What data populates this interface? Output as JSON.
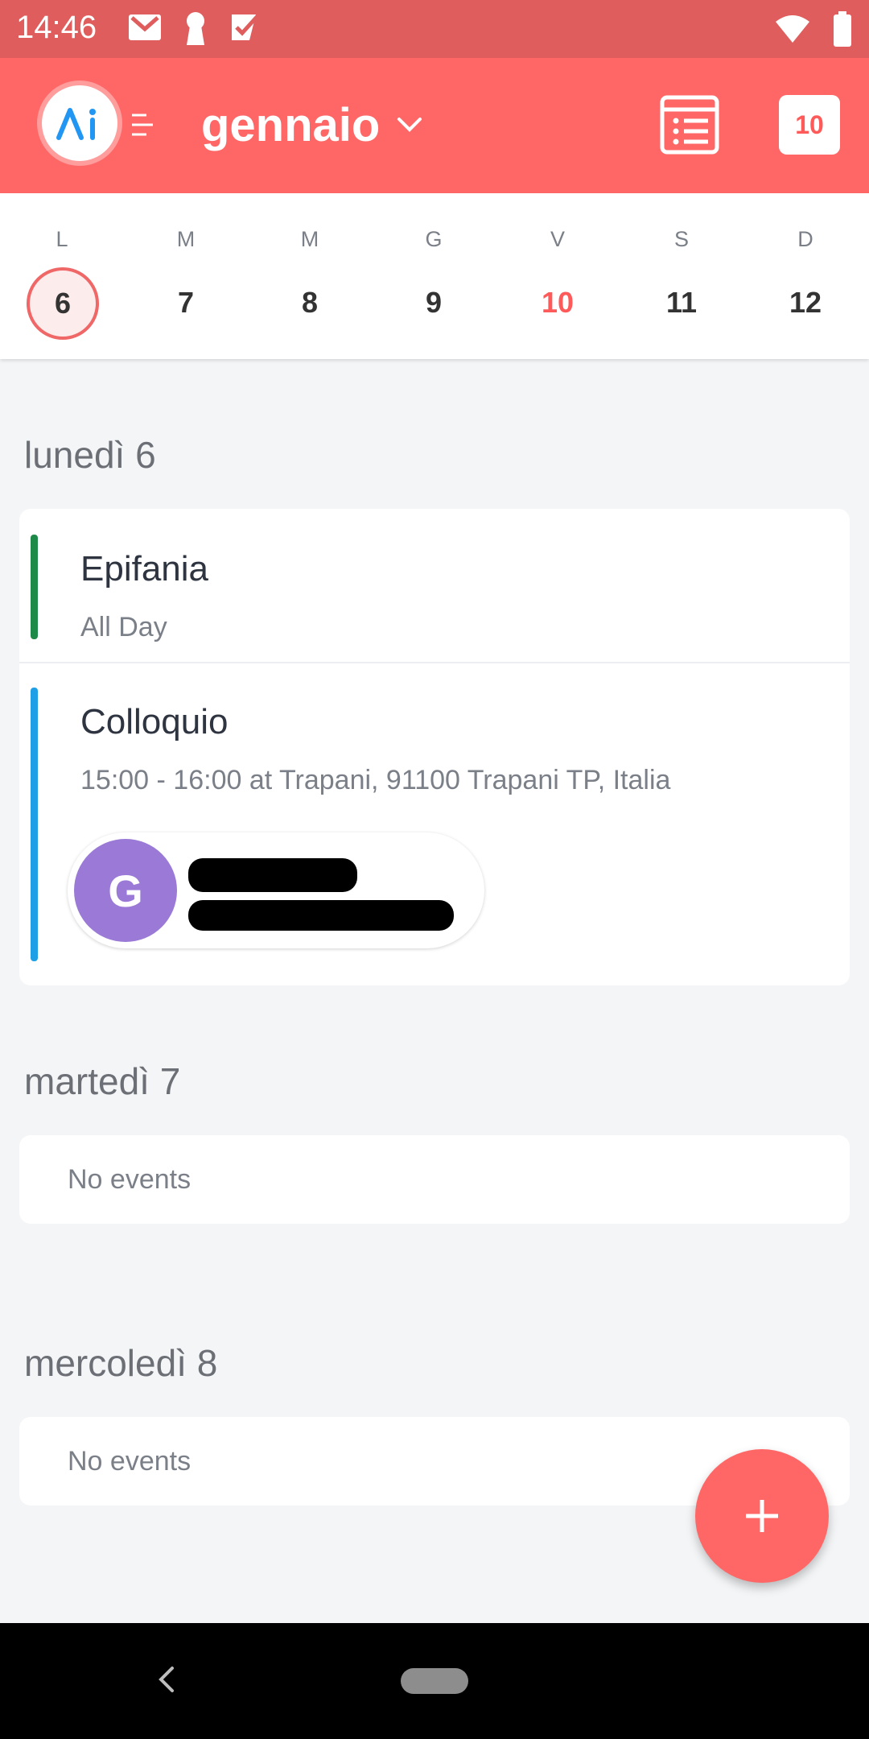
{
  "status_bar": {
    "time": "14:46",
    "left_icons": [
      "gmail-icon",
      "keyhole-icon",
      "task-check-icon"
    ],
    "right_icons": [
      "wifi-icon",
      "battery-icon"
    ]
  },
  "app_bar": {
    "logo_text": "Ai",
    "month": "gennaio",
    "today_badge": "10",
    "accent": "#ff6767"
  },
  "week": [
    {
      "dow": "L",
      "num": "6",
      "state": "selected"
    },
    {
      "dow": "M",
      "num": "7",
      "state": ""
    },
    {
      "dow": "M",
      "num": "8",
      "state": ""
    },
    {
      "dow": "G",
      "num": "9",
      "state": ""
    },
    {
      "dow": "V",
      "num": "10",
      "state": "today"
    },
    {
      "dow": "S",
      "num": "11",
      "state": ""
    },
    {
      "dow": "D",
      "num": "12",
      "state": ""
    }
  ],
  "days": {
    "mon": {
      "heading": "lunedì 6",
      "events": [
        {
          "title": "Epifania",
          "subtitle": "All Day",
          "color": "#1e8a4a"
        },
        {
          "title": "Colloquio",
          "subtitle": "15:00 - 16:00 at Trapani, 91100 Trapani TP, Italia",
          "color": "#1ea0e6"
        }
      ],
      "attendee_initial": "G"
    },
    "tue": {
      "heading": "martedì 7",
      "empty": "No events"
    },
    "wed": {
      "heading": "mercoledì 8",
      "empty": "No events"
    }
  },
  "fab": {
    "icon": "plus-icon"
  },
  "nav": {
    "icons": [
      "back-icon",
      "home-pill"
    ]
  }
}
